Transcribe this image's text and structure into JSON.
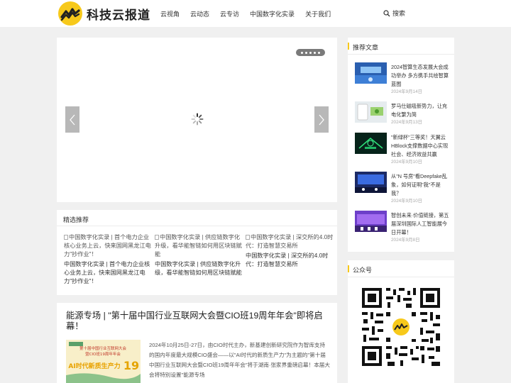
{
  "header": {
    "site_name": "科技云报道",
    "nav": [
      "云视角",
      "云动态",
      "云专访",
      "中国数字化实录",
      "关于我们"
    ],
    "search_label": "搜索"
  },
  "slider": {
    "dot_count": 5
  },
  "featured": {
    "title": "精选推荐",
    "items": [
      {
        "alt": "中国数字化实录 | 首个电力企业核心业务上云，快来国网黑龙江电力\"抄作业\"！",
        "caption": "中国数字化实录 | 首个电力企业核心业务上云，快来国网黑龙江电力\"抄作业\"！"
      },
      {
        "alt": "中国数字化实录 | 供应链数字化升级，看华能智链如何用区块链赋能",
        "caption": "中国数字化实录 | 供应链数字化升级，看华能智链如何用区块链赋能"
      },
      {
        "alt": "中国数字化实录 | 深交所的4.0时代：打造智慧交易所",
        "caption": "中国数字化实录 | 深交所的4.0时代：打造智慧交易所"
      }
    ]
  },
  "article": {
    "title": "能源专场 | \"第十届中国行业互联网大会暨CIO班19周年年会\"即将启幕！",
    "excerpt": "2024年10月25日-27日，由CIO时代主办，新基建创新研究院作为智库支持的国内年度最大规模CIO盛会——以\"AI时代的新质生产力\"为主题的\"第十届中国行业互联网大会暨CIO班19周年年会\"将于湖南·张家界重磅启幕！本届大会将特别设置\"能源专场",
    "thumb_text": [
      "第十届中国行业互联网大会",
      "暨CIO班19周年年会",
      "AI时代新质生产力"
    ]
  },
  "sidebar": {
    "recommended_title": "推荐文章",
    "recommended": [
      {
        "title": "2024智算生态发展大会成功举办 多方携手共绘智算蓝图",
        "date": "2024年9月14日"
      },
      {
        "title": "罗马仕磁吸新势力，让充电化繁为简",
        "date": "2024年9月13日"
      },
      {
        "title": "\"新绿杯\"三等奖！天翼云HBlock支撑数据中心实现社会、经济效益共赢",
        "date": "2024年9月10日"
      },
      {
        "title": "从\"N 号房\"看Deepfake乱象，如何证明\"我\"不是我？",
        "date": "2024年9月10日"
      },
      {
        "title": "智创未来·价值链接，第五届深圳国际人工智能展今日开幕！",
        "date": "2024年9月8日"
      }
    ],
    "wechat_title": "公众号"
  },
  "colors": {
    "brand_yellow": "#f7c91b",
    "background": "#f0f0f0",
    "card": "#ffffff"
  }
}
